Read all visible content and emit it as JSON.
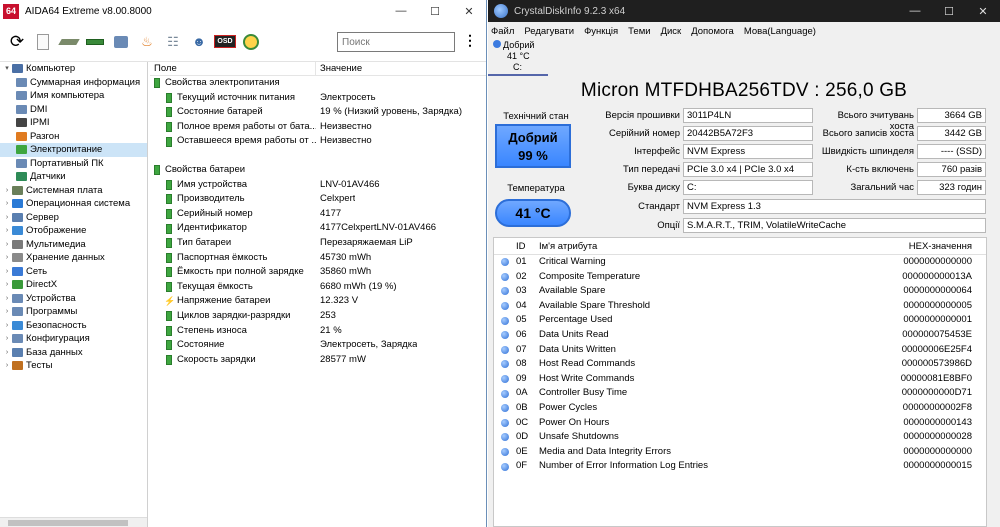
{
  "aida": {
    "title": "AIDA64 Extreme v8.00.8000",
    "icon_label": "64",
    "search_placeholder": "Поиск",
    "toolbar_icons": [
      "refresh-icon",
      "report-icon",
      "motherboard-icon",
      "memory-icon",
      "network-icon",
      "flame-icon",
      "network-tree-icon",
      "user-icon",
      "osd-icon",
      "gauge-icon"
    ],
    "osd_label": "OSD",
    "tree": [
      {
        "label": "Компьютер",
        "level": 0,
        "arrow": "▾",
        "color": "#4a6fa5"
      },
      {
        "label": "Суммарная информация",
        "level": 1,
        "color": "#6a8ab5"
      },
      {
        "label": "Имя компьютера",
        "level": 1,
        "color": "#6a8ab5"
      },
      {
        "label": "DMI",
        "level": 1,
        "color": "#6a8ab5"
      },
      {
        "label": "IPMI",
        "level": 1,
        "color": "#444444"
      },
      {
        "label": "Разгон",
        "level": 1,
        "color": "#e07b20"
      },
      {
        "label": "Электропитание",
        "level": 1,
        "color": "#3ea640",
        "selected": true
      },
      {
        "label": "Портативный ПК",
        "level": 1,
        "color": "#6a8ab5"
      },
      {
        "label": "Датчики",
        "level": 1,
        "color": "#2e8b57"
      },
      {
        "label": "Системная плата",
        "level": 0,
        "arrow": "›",
        "color": "#6a7f5a"
      },
      {
        "label": "Операционная система",
        "level": 0,
        "arrow": "›",
        "color": "#2a7ad6"
      },
      {
        "label": "Сервер",
        "level": 0,
        "arrow": "›",
        "color": "#5a7fb0"
      },
      {
        "label": "Отображение",
        "level": 0,
        "arrow": "›",
        "color": "#3a8ad6"
      },
      {
        "label": "Мультимедиа",
        "level": 0,
        "arrow": "›",
        "color": "#7a7a7a"
      },
      {
        "label": "Хранение данных",
        "level": 0,
        "arrow": "›",
        "color": "#8a8a8a"
      },
      {
        "label": "Сеть",
        "level": 0,
        "arrow": "›",
        "color": "#3a7ad6"
      },
      {
        "label": "DirectX",
        "level": 0,
        "arrow": "›",
        "color": "#3a9a3a"
      },
      {
        "label": "Устройства",
        "level": 0,
        "arrow": "›",
        "color": "#6a8ab5"
      },
      {
        "label": "Программы",
        "level": 0,
        "arrow": "›",
        "color": "#6a8ab5"
      },
      {
        "label": "Безопасность",
        "level": 0,
        "arrow": "›",
        "color": "#3a8ad6"
      },
      {
        "label": "Конфигурация",
        "level": 0,
        "arrow": "›",
        "color": "#6a8ab5"
      },
      {
        "label": "База данных",
        "level": 0,
        "arrow": "›",
        "color": "#5a7fb0"
      },
      {
        "label": "Тесты",
        "level": 0,
        "arrow": "›",
        "color": "#c07020"
      }
    ],
    "columns": {
      "field": "Поле",
      "value": "Значение"
    },
    "power_group": "Свойства электропитания",
    "power_rows": [
      {
        "field": "Текущий источник питания",
        "value": "Электросеть"
      },
      {
        "field": "Состояние батарей",
        "value": "19 % (Низкий уровень, Зарядка)"
      },
      {
        "field": "Полное время работы от бата...",
        "value": "Неизвестно"
      },
      {
        "field": "Оставшееся время работы от ...",
        "value": "Неизвестно"
      }
    ],
    "battery_group": "Свойства батареи",
    "battery_rows": [
      {
        "field": "Имя устройства",
        "value": "LNV-01AV466",
        "icon": "battery"
      },
      {
        "field": "Производитель",
        "value": "Celxpert",
        "icon": "battery"
      },
      {
        "field": "Серийный номер",
        "value": "4177",
        "icon": "battery"
      },
      {
        "field": "Идентификатор",
        "value": "4177CelxpertLNV-01AV466",
        "icon": "battery"
      },
      {
        "field": "Тип батареи",
        "value": "Перезаряжаемая LiP",
        "icon": "battery"
      },
      {
        "field": "Паспортная ёмкость",
        "value": "45730 mWh",
        "icon": "battery"
      },
      {
        "field": "Ёмкость при полной зарядке",
        "value": "35860 mWh",
        "icon": "battery"
      },
      {
        "field": "Текущая ёмкость",
        "value": "6680 mWh  (19 %)",
        "icon": "battery"
      },
      {
        "field": "Напряжение батареи",
        "value": "12.323 V",
        "icon": "bolt"
      },
      {
        "field": "Циклов зарядки-разрядки",
        "value": "253",
        "icon": "battery"
      },
      {
        "field": "Степень износа",
        "value": "21 %",
        "icon": "battery"
      },
      {
        "field": "Состояние",
        "value": "Электросеть, Зарядка",
        "icon": "battery"
      },
      {
        "field": "Скорость зарядки",
        "value": "28577 mW",
        "icon": "battery"
      }
    ]
  },
  "cdi": {
    "title": "CrystalDiskInfo 9.2.3 x64",
    "menu": [
      "Файл",
      "Редагувати",
      "Функція",
      "Теми",
      "Диск",
      "Допомога",
      "Мова(Language)"
    ],
    "status_tab": {
      "health": "Добрий",
      "temp": "41 °C",
      "drive": "C:"
    },
    "model": "Micron MTFDHBA256TDV : 256,0 GB",
    "health_label": "Технічний стан",
    "health_value": "Добрий",
    "health_percent": "99 %",
    "temp_label": "Температура",
    "temp_value": "41 °C",
    "info_left": [
      {
        "label": "Версія прошивки",
        "value": "3011P4LN"
      },
      {
        "label": "Серійний номер",
        "value": "20442B5A72F3"
      },
      {
        "label": "Інтерфейс",
        "value": "NVM Express"
      },
      {
        "label": "Тип передачі",
        "value": "PCIe 3.0 x4 | PCIe 3.0 x4"
      },
      {
        "label": "Буква диску",
        "value": "C:"
      }
    ],
    "info_right": [
      {
        "label": "Всього зчитувань хоста",
        "value": "3664 GB"
      },
      {
        "label": "Всього записів хоста",
        "value": "3442 GB"
      },
      {
        "label": "Швидкість шпинделя",
        "value": "---- (SSD)"
      },
      {
        "label": "К-сть включень",
        "value": "760 разів"
      },
      {
        "label": "Загальний час",
        "value": "323 годин"
      }
    ],
    "standard_label": "Стандарт",
    "standard_value": "NVM Express 1.3",
    "options_label": "Опції",
    "options_value": "S.M.A.R.T., TRIM, VolatileWriteCache",
    "smart_headers": {
      "id": "ID",
      "name": "Ім'я атрибута",
      "hex": "HEX-значення"
    },
    "smart_rows": [
      {
        "id": "01",
        "name": "Critical Warning",
        "hex": "0000000000000"
      },
      {
        "id": "02",
        "name": "Composite Temperature",
        "hex": "000000000013A"
      },
      {
        "id": "03",
        "name": "Available Spare",
        "hex": "0000000000064"
      },
      {
        "id": "04",
        "name": "Available Spare Threshold",
        "hex": "0000000000005"
      },
      {
        "id": "05",
        "name": "Percentage Used",
        "hex": "0000000000001"
      },
      {
        "id": "06",
        "name": "Data Units Read",
        "hex": "000000075453E"
      },
      {
        "id": "07",
        "name": "Data Units Written",
        "hex": "00000006E25F4"
      },
      {
        "id": "08",
        "name": "Host Read Commands",
        "hex": "000000573986D"
      },
      {
        "id": "09",
        "name": "Host Write Commands",
        "hex": "00000081E8BF0"
      },
      {
        "id": "0A",
        "name": "Controller Busy Time",
        "hex": "0000000000D71"
      },
      {
        "id": "0B",
        "name": "Power Cycles",
        "hex": "00000000002F8"
      },
      {
        "id": "0C",
        "name": "Power On Hours",
        "hex": "0000000000143"
      },
      {
        "id": "0D",
        "name": "Unsafe Shutdowns",
        "hex": "0000000000028"
      },
      {
        "id": "0E",
        "name": "Media and Data Integrity Errors",
        "hex": "0000000000000"
      },
      {
        "id": "0F",
        "name": "Number of Error Information Log Entries",
        "hex": "0000000000015"
      }
    ]
  }
}
